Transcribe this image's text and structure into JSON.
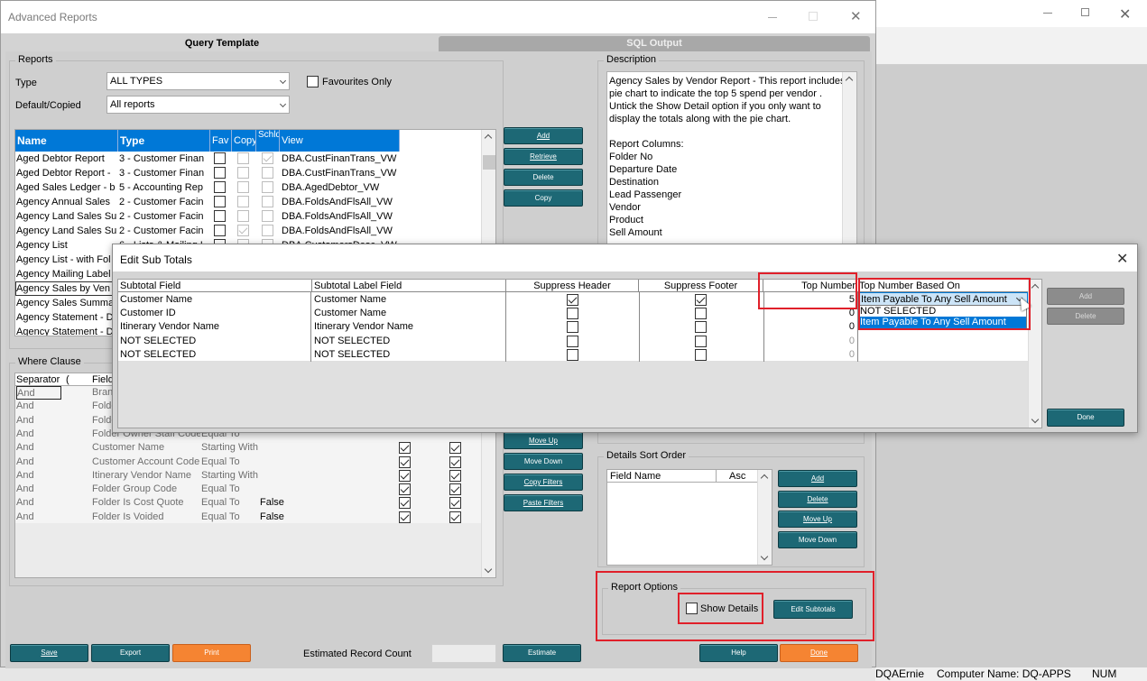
{
  "window": {
    "title": "Advanced Reports"
  },
  "tabs": [
    {
      "label": "Query Template"
    },
    {
      "label": "SQL Output"
    }
  ],
  "reports": {
    "group_label": "Reports",
    "type_label": "Type",
    "type_value": "ALL TYPES",
    "favourites_label": "Favourites Only",
    "default_label": "Default/Copied",
    "default_value": "All reports",
    "columns": [
      "Name",
      "Type",
      "Fav",
      "Copy",
      "Schld",
      "View"
    ],
    "rows": [
      {
        "name": "Aged Debtor Report",
        "type": "3 - Customer Finan",
        "view": "DBA.CustFinanTrans_VW",
        "fav": false,
        "copy": false,
        "schld": true
      },
      {
        "name": "Aged Debtor Report -",
        "type": "3 - Customer Finan",
        "view": "DBA.CustFinanTrans_VW",
        "fav": false,
        "copy": false,
        "schld": false
      },
      {
        "name": "Aged Sales Ledger - b",
        "type": "5 - Accounting Rep",
        "view": "DBA.AgedDebtor_VW",
        "fav": false,
        "copy": false,
        "schld": false
      },
      {
        "name": "Agency Annual Sales",
        "type": "2 - Customer Facin",
        "view": "DBA.FoldsAndFlsAll_VW",
        "fav": false,
        "copy": false,
        "schld": false
      },
      {
        "name": "Agency Land Sales Su",
        "type": "2 - Customer Facin",
        "view": "DBA.FoldsAndFlsAll_VW",
        "fav": false,
        "copy": false,
        "schld": false
      },
      {
        "name": "Agency Land Sales Su",
        "type": "2 - Customer Facin",
        "view": "DBA.FoldsAndFlsAll_VW",
        "fav": false,
        "copy": true,
        "schld": false
      },
      {
        "name": "Agency List",
        "type": "6 - Lists & Mailing L",
        "view": "DBA.CustomersDesc_VW",
        "fav": false,
        "copy": false,
        "schld": false
      },
      {
        "name": "Agency List - with Fol",
        "type": "",
        "view": "",
        "fav": null,
        "copy": null,
        "schld": null
      },
      {
        "name": "Agency Mailing Label",
        "type": "",
        "view": "",
        "fav": null,
        "copy": null,
        "schld": null
      },
      {
        "name": "Agency Sales by Ven",
        "type": "",
        "view": "",
        "fav": null,
        "copy": null,
        "schld": null
      },
      {
        "name": "Agency Sales Summa",
        "type": "",
        "view": "",
        "fav": null,
        "copy": null,
        "schld": null
      },
      {
        "name": "Agency Statement - D",
        "type": "",
        "view": "",
        "fav": null,
        "copy": null,
        "schld": null
      },
      {
        "name": "Agency Statement - D",
        "type": "",
        "view": "",
        "fav": null,
        "copy": null,
        "schld": null
      }
    ]
  },
  "report_buttons": [
    "Add",
    "Retrieve",
    "Delete",
    "Copy"
  ],
  "description": {
    "group_label": "Description",
    "lines": [
      "Agency Sales by Vendor Report - This report includes a",
      "pie chart to indicate the top 5 spend per vendor .",
      "Untick the Show Detail option if you only want to",
      "display the totals along with the pie chart.",
      "",
      "Report Columns:",
      "Folder No",
      "Departure Date",
      "Destination",
      "Lead Passenger",
      "Vendor",
      "Product",
      "Sell Amount"
    ]
  },
  "where_clause": {
    "group_label": "Where Clause",
    "columns": [
      "Separator",
      "(",
      "Field"
    ],
    "rows": [
      {
        "sep": "And",
        "field": "Bran",
        "op": "",
        "value": "",
        "c1": null,
        "c2": null
      },
      {
        "sep": "And",
        "field": "Folde",
        "op": "",
        "value": "",
        "c1": null,
        "c2": null
      },
      {
        "sep": "And",
        "field": "Folde",
        "op": "",
        "value": "",
        "c1": null,
        "c2": null
      },
      {
        "sep": "And",
        "field": "Folder Owner Staff Code",
        "op": "Equal To",
        "value": "",
        "c1": null,
        "c2": null
      },
      {
        "sep": "And",
        "field": "Customer Name",
        "op": "Starting With",
        "value": "",
        "c1": true,
        "c2": true
      },
      {
        "sep": "And",
        "field": "Customer Account Code",
        "op": "Equal To",
        "value": "",
        "c1": true,
        "c2": true
      },
      {
        "sep": "And",
        "field": "Itinerary Vendor Name",
        "op": "Starting With",
        "value": "",
        "c1": true,
        "c2": true
      },
      {
        "sep": "And",
        "field": "Folder Group Code",
        "op": "Equal To",
        "value": "",
        "c1": true,
        "c2": true
      },
      {
        "sep": "And",
        "field": "Folder Is Cost Quote",
        "op": "Equal To",
        "value": "False",
        "c1": true,
        "c2": true
      },
      {
        "sep": "And",
        "field": "Folder Is Voided",
        "op": "Equal To",
        "value": "False",
        "c1": true,
        "c2": true
      }
    ]
  },
  "where_buttons": [
    "Move Up",
    "Move Down",
    "Copy Filters",
    "Paste Filters"
  ],
  "details_sort": {
    "group_label": "Details Sort Order",
    "columns": [
      "Field Name",
      "Asc"
    ],
    "buttons": [
      "Add",
      "Delete",
      "Move Up",
      "Move Down"
    ]
  },
  "report_options": {
    "group_label": "Report Options",
    "show_details_label": "Show Details",
    "show_details_checked": false,
    "edit_subtotals_label": "Edit Subtotals"
  },
  "footer": {
    "save": "Save",
    "export": "Export",
    "print": "Print",
    "estimated_label": "Estimated Record Count",
    "estimated_value": "",
    "estimate": "Estimate",
    "help": "Help",
    "done": "Done"
  },
  "dialog": {
    "title": "Edit Sub Totals",
    "columns": [
      "Subtotal Field",
      "Subtotal Label Field",
      "Suppress Header",
      "Suppress Footer",
      "Top Number",
      "Top Number Based On"
    ],
    "rows": [
      {
        "field": "Customer Name",
        "label": "Customer Name",
        "sh": true,
        "sf": true,
        "top": "5",
        "based": "Item Payable To Any Sell Amount",
        "active": true
      },
      {
        "field": "Customer ID",
        "label": "Customer Name",
        "sh": false,
        "sf": false,
        "top": "0",
        "based": "",
        "active": true
      },
      {
        "field": "Itinerary Vendor Name",
        "label": "Itinerary Vendor Name",
        "sh": false,
        "sf": false,
        "top": "0",
        "based": "",
        "active": true
      },
      {
        "field": "NOT SELECTED",
        "label": "NOT SELECTED",
        "sh": false,
        "sf": false,
        "top": "0",
        "based": "",
        "active": false
      },
      {
        "field": "NOT SELECTED",
        "label": "NOT SELECTED",
        "sh": false,
        "sf": false,
        "top": "0",
        "based": "",
        "active": false
      }
    ],
    "dropdown_options": [
      "NOT SELECTED",
      "Item Payable To Any Sell Amount"
    ],
    "buttons": {
      "add": "Add",
      "delete": "Delete",
      "done": "Done"
    }
  },
  "background_window": {
    "status": [
      "DQAErnie",
      "Computer Name: DQ-APPS",
      "NUM"
    ]
  }
}
